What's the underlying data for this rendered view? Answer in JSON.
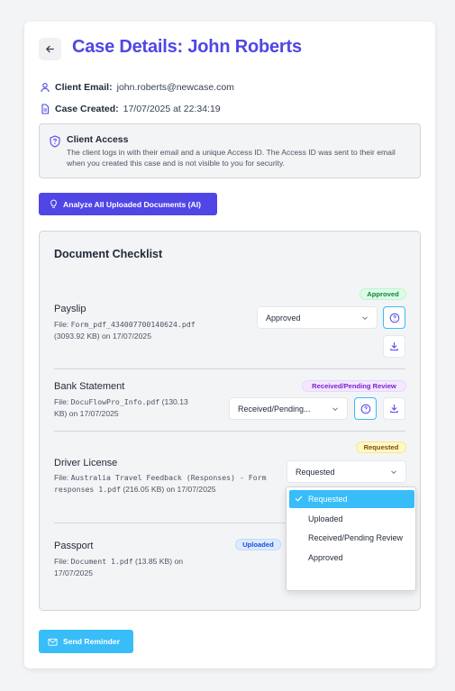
{
  "header": {
    "title": "Case Details: John Roberts"
  },
  "meta": {
    "email_label": "Client Email:",
    "email_value": "john.roberts@newcase.com",
    "created_label": "Case Created:",
    "created_value": "17/07/2025 at 22:34:19"
  },
  "client_access": {
    "title": "Client Access",
    "text": "The client logs in with their email and a unique Access ID. The Access ID was sent to their email when you created this case and is not visible to you for security."
  },
  "ai_button": {
    "label": "Analyze All Uploaded Documents (AI)"
  },
  "checklist": {
    "title": "Document Checklist",
    "documents": [
      {
        "name": "Payslip",
        "file_prefix": "File: ",
        "file_name": "Form_pdf_434007700140624.pdf",
        "file_meta": "(3093.92 KB) on 17/07/2025",
        "status_badge": "Approved",
        "select_value": "Approved"
      },
      {
        "name": "Bank Statement",
        "file_prefix": "File: ",
        "file_name": "DocuFlowPro_Info.pdf",
        "file_meta": "(130.13 KB) on 17/07/2025",
        "status_badge": "Received/Pending Review",
        "select_value": "Received/Pending..."
      },
      {
        "name": "Driver License",
        "file_prefix": "File: ",
        "file_name": "Australia Travel Feedback (Responses) - Form responses 1.pdf",
        "file_meta": "(216.05 KB) on 17/07/2025",
        "status_badge": "Requested",
        "select_value": "Requested"
      },
      {
        "name": "Passport",
        "file_prefix": "File: ",
        "file_name": "Document 1.pdf",
        "file_meta": "(13.85 KB) on 17/07/2025",
        "status_badge": "Uploaded"
      }
    ]
  },
  "status_dropdown": {
    "options": [
      "Requested",
      "Uploaded",
      "Received/Pending Review",
      "Approved"
    ],
    "selected": "Requested"
  },
  "reminder_button": {
    "label": "Send Reminder"
  },
  "colors": {
    "primary": "#4f46e5",
    "accent": "#38bdf8",
    "approved": "#15803d",
    "review": "#7e22ce",
    "requested": "#854d0e",
    "uploaded": "#1d4ed8"
  },
  "icons": [
    "arrow-left-icon",
    "user-icon",
    "document-icon",
    "shield-question-icon",
    "lightbulb-icon",
    "help-circle-icon",
    "download-icon",
    "chevron-down-icon",
    "check-icon",
    "mail-icon"
  ]
}
